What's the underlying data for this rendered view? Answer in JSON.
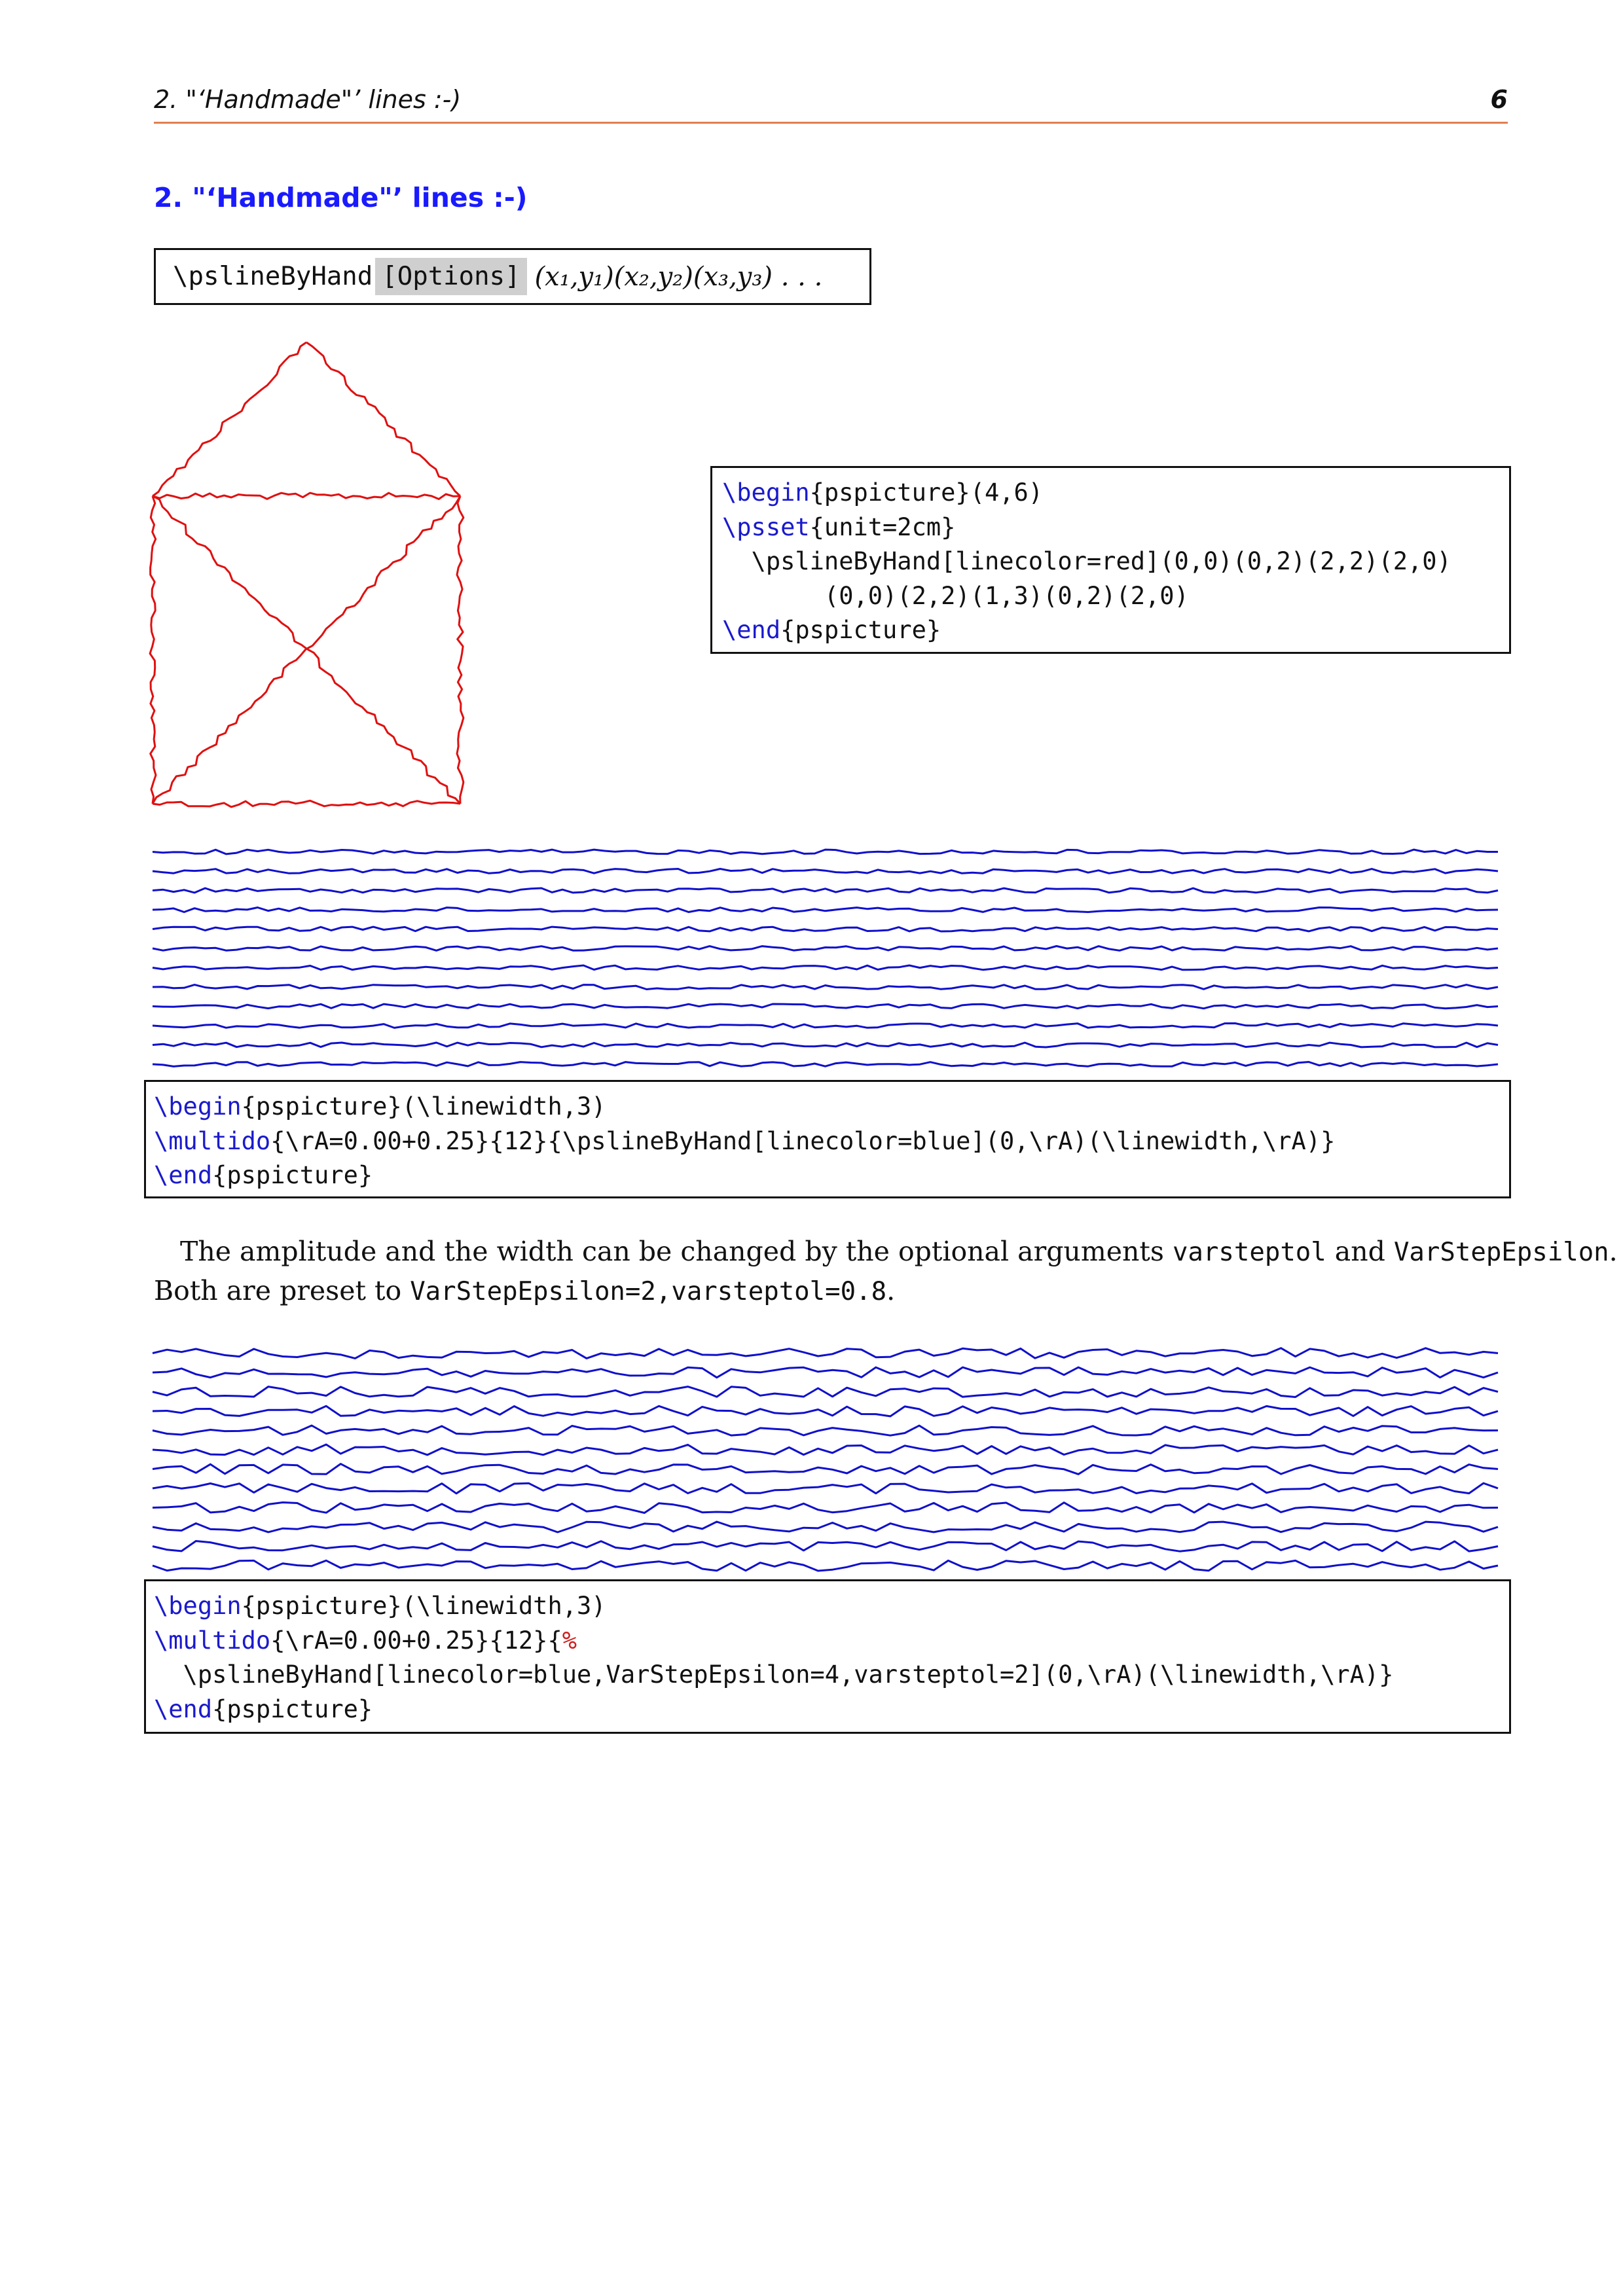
{
  "header": {
    "section_label": "2. \"‘Handmade\"’ lines :-)",
    "page_number": "6"
  },
  "section": {
    "number": "2.",
    "title": "\"‘Handmade\"’ lines :-)"
  },
  "syntax": {
    "command": "\\pslineByHand",
    "options": "[Options]",
    "args": "(x₁,y₁)(x₂,y₂)(x₃,y₃) . . ."
  },
  "figure1": {
    "stroke_color": "#e01010",
    "points": [
      [
        0,
        0
      ],
      [
        0,
        2
      ],
      [
        2,
        2
      ],
      [
        2,
        0
      ],
      [
        0,
        0
      ],
      [
        2,
        2
      ],
      [
        1,
        3
      ],
      [
        0,
        2
      ],
      [
        2,
        0
      ]
    ]
  },
  "code1": {
    "lines": [
      {
        "kw": "\\begin",
        "rest": "{pspicture}(4,6)"
      },
      {
        "kw": "\\psset",
        "rest": "{unit=2cm}"
      },
      {
        "kw": "",
        "rest": "  \\pslineByHand[linecolor=red](0,0)(0,2)(2,2)(2,0)"
      },
      {
        "kw": "",
        "rest": "       (0,0)(2,2)(1,3)(0,2)(2,0)"
      },
      {
        "kw": "\\end",
        "rest": "{pspicture}"
      }
    ]
  },
  "figure2": {
    "stroke_color": "#1010cc",
    "line_count": 12,
    "y_start": 0.0,
    "y_step": 0.25,
    "VarStepEpsilon": 2,
    "varsteptol": 0.8
  },
  "code2": {
    "lines": [
      {
        "kw": "\\begin",
        "rest": "{pspicture}(\\linewidth,3)"
      },
      {
        "kw": "\\multido",
        "rest": "{\\rA=0.00+0.25}{12}{\\pslineByHand[linecolor=blue](0,\\rA)(\\linewidth,\\rA)}"
      },
      {
        "kw": "\\end",
        "rest": "{pspicture}"
      }
    ]
  },
  "paragraph": {
    "line1_a": "The amplitude and the width can be changed by the optional arguments ",
    "line1_code1": "varsteptol",
    "line1_b": " and ",
    "line1_code2": "VarStepEpsilon",
    "line1_c": ".",
    "line2_a": "Both are preset to ",
    "line2_code": "VarStepEpsilon=2,varsteptol=0.8",
    "line2_b": "."
  },
  "figure3": {
    "stroke_color": "#1010cc",
    "line_count": 12,
    "y_start": 0.0,
    "y_step": 0.25,
    "VarStepEpsilon": 4,
    "varsteptol": 2
  },
  "code3": {
    "lines": [
      {
        "kw": "\\begin",
        "rest": "{pspicture}(\\linewidth,3)"
      },
      {
        "kw": "\\multido",
        "rest": "{\\rA=0.00+0.25}{12}{",
        "comment": "%"
      },
      {
        "kw": "",
        "rest": "  \\pslineByHand[linecolor=blue,VarStepEpsilon=4,varsteptol=2](0,\\rA)(\\linewidth,\\rA)}"
      },
      {
        "kw": "\\end",
        "rest": "{pspicture}"
      }
    ]
  }
}
